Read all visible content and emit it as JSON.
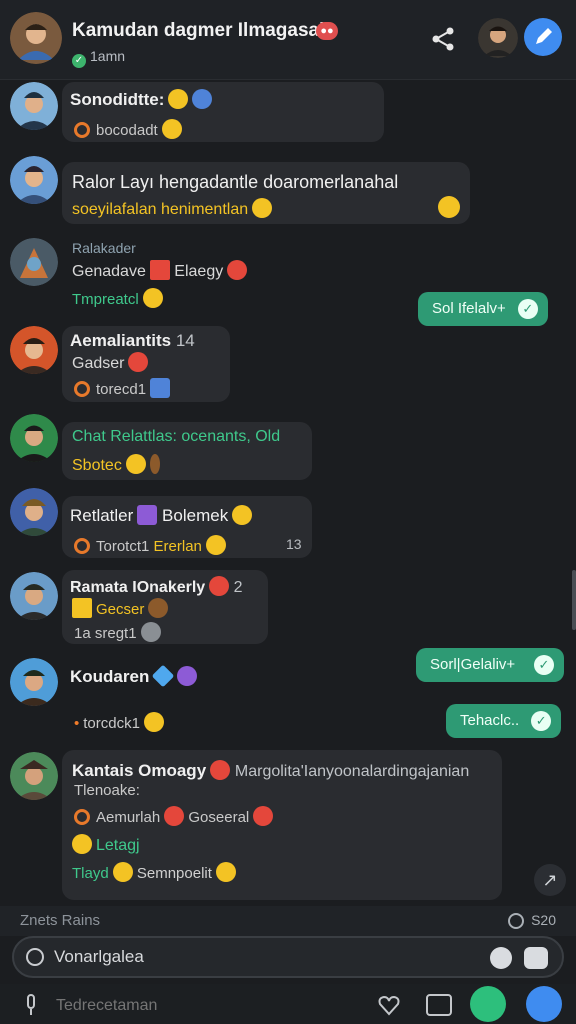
{
  "header": {
    "title": "Kamudan dagmer Ilmagasai",
    "status": "1amn"
  },
  "messages": [
    {
      "name": "Sonodidtte:",
      "line1": "bocodadt"
    },
    {
      "name": "Ralor Layı hengadantle doaromerlanahal",
      "line1": "soeyilafalan henimentlan"
    },
    {
      "name": "Ralakader",
      "line1": "Genadave",
      "line1b": "Elaegy",
      "line2": "Tmpreatcl"
    },
    {
      "name": "Aemaliantits",
      "name_extra": "14",
      "line1": "Gadser",
      "line2": "torecd1"
    },
    {
      "name": "Chat Relattlas:",
      "name_extra": "ocenants, Old",
      "line1": "Sbotec"
    },
    {
      "name": "Retlatler",
      "name_extra": "Bolemek",
      "line1": "Torotct1",
      "line1b": "Ererlan",
      "time": "13"
    },
    {
      "name": "Ramata IOnakerly",
      "name_extra": "2",
      "line1": "Gecser",
      "line2": "1a sregt1"
    },
    {
      "name": "Koudaren",
      "line1": "torcdck1"
    },
    {
      "name": "Kantais Omoagy",
      "name_extra": "Margolita'Ianyoonalardingajanian",
      "line1": "Tlenoake:",
      "line2": "Aemurlah",
      "line2b": "Goseeral",
      "line3": "Letagj",
      "line4a": "Tlayd",
      "line4b": "Semnpoelit"
    }
  ],
  "outgoing": [
    {
      "text": "Sol Ifelalv+",
      "check": "✓"
    },
    {
      "text": "Sorl|Gelaliv+",
      "check": "✓"
    },
    {
      "text": "Tehaclc..",
      "check": "✓"
    }
  ],
  "typing": {
    "text": "Znets Rains",
    "count": "S20"
  },
  "search": {
    "value": "Vonarlgalea"
  },
  "composer": {
    "placeholder": "Tedrecetaman"
  },
  "scroll_glyph": "↗",
  "colors": {
    "accent_blue": "#3f8cf0",
    "accent_green": "#2e9a74",
    "badge_red": "#e04f4f"
  }
}
